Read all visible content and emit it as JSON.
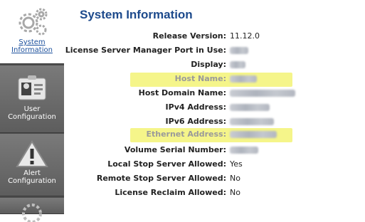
{
  "sidebar": {
    "items": [
      {
        "label1": "System",
        "label2": "Information",
        "icon": "gears-icon"
      },
      {
        "label1": "User",
        "label2": "Configuration",
        "icon": "id-badge-icon"
      },
      {
        "label1": "Alert",
        "label2": "Configuration",
        "icon": "warning-icon"
      }
    ]
  },
  "main": {
    "title": "System Information",
    "rows": [
      {
        "label": "Release Version:",
        "value": "11.12.0"
      },
      {
        "label": "License Server Manager Port in Use:",
        "value": ""
      },
      {
        "label": "Display:",
        "value": ""
      },
      {
        "label": "Host Name:",
        "value": ""
      },
      {
        "label": "Host Domain Name:",
        "value": ""
      },
      {
        "label": "IPv4 Address:",
        "value": ""
      },
      {
        "label": "IPv6 Address:",
        "value": ""
      },
      {
        "label": "Ethernet Address:",
        "value": ""
      },
      {
        "label": "Volume Serial Number:",
        "value": ""
      },
      {
        "label": "Local Stop Server Allowed:",
        "value": "Yes"
      },
      {
        "label": "Remote Stop Server Allowed:",
        "value": "No"
      },
      {
        "label": "License Reclaim Allowed:",
        "value": "No"
      }
    ]
  },
  "colors": {
    "title": "#1d4a8c",
    "highlight": "#f5f58a",
    "sidebar": "#5d5d5d"
  }
}
